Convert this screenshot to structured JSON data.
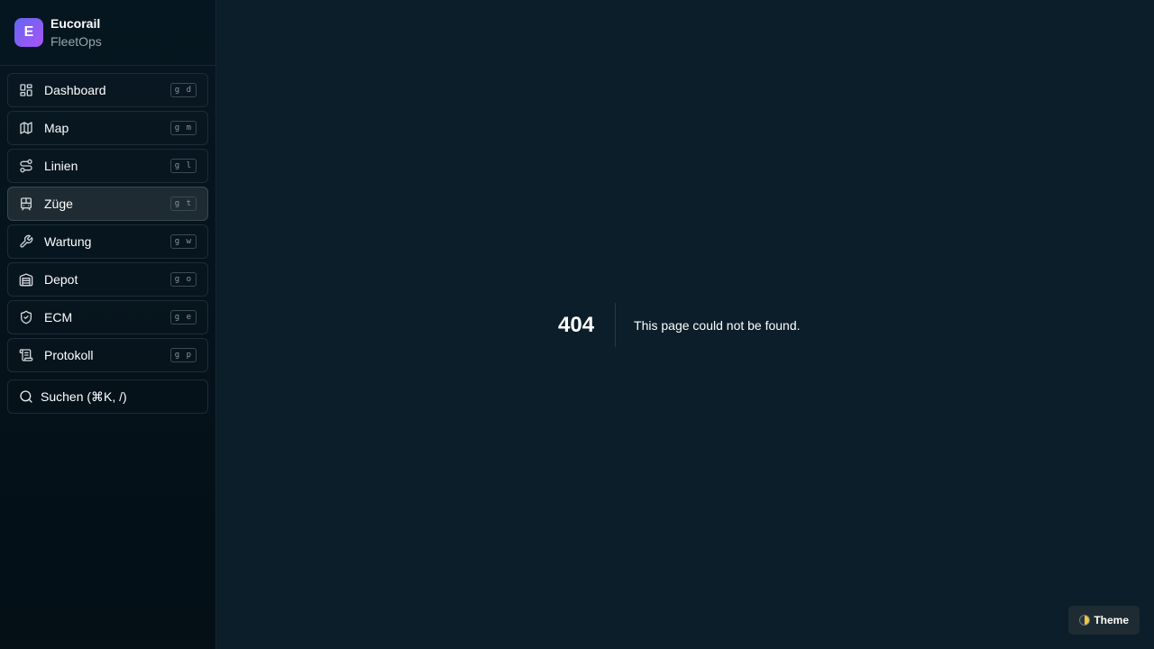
{
  "brand": {
    "initial": "E",
    "name": "Eucorail",
    "subtitle": "FleetOps"
  },
  "nav": [
    {
      "label": "Dashboard",
      "shortcut": "g d",
      "icon": "dashboard-icon"
    },
    {
      "label": "Map",
      "shortcut": "g m",
      "icon": "map-icon"
    },
    {
      "label": "Linien",
      "shortcut": "g l",
      "icon": "route-icon"
    },
    {
      "label": "Züge",
      "shortcut": "g t",
      "icon": "train-icon",
      "active": true
    },
    {
      "label": "Wartung",
      "shortcut": "g w",
      "icon": "wrench-icon"
    },
    {
      "label": "Depot",
      "shortcut": "g o",
      "icon": "warehouse-icon"
    },
    {
      "label": "ECM",
      "shortcut": "g e",
      "icon": "shield-check-icon"
    },
    {
      "label": "Protokoll",
      "shortcut": "g p",
      "icon": "scroll-icon"
    }
  ],
  "search": {
    "label": "Suchen (⌘K, /)"
  },
  "notfound": {
    "code": "404",
    "message": "This page could not be found."
  },
  "theme": {
    "label": "Theme"
  },
  "colors": {
    "background": "#0b1e29",
    "sidebar": "#061620",
    "active_item": "#1f2b32",
    "accent_start": "#6366f1",
    "accent_end": "#a855f7"
  }
}
